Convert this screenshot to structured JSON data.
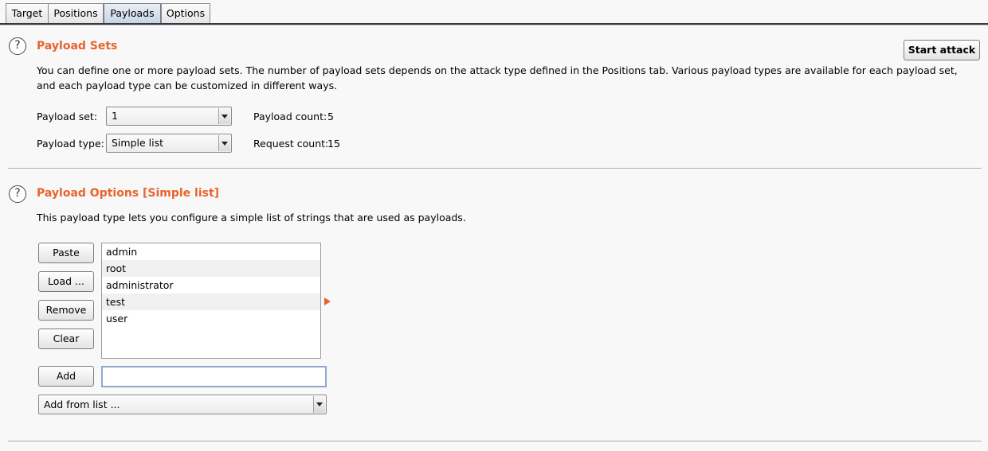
{
  "tabs": [
    {
      "label": "Target"
    },
    {
      "label": "Positions"
    },
    {
      "label": "Payloads",
      "active": true
    },
    {
      "label": "Options"
    }
  ],
  "payload_sets": {
    "title": "Payload Sets",
    "description_line1": "You can define one or more payload sets. The number of payload sets depends on the attack type defined in the Positions tab. Various payload types are available for each payload set,",
    "description_line2": "and each payload type can be customized in different ways.",
    "start_attack_label": "Start attack",
    "payload_set_label": "Payload set:",
    "payload_set_value": "1",
    "payload_type_label": "Payload type:",
    "payload_type_value": "Simple list",
    "payload_count_label": "Payload count:",
    "payload_count_value": "5",
    "request_count_label": "Request count:",
    "request_count_value": "15"
  },
  "payload_options": {
    "title": "Payload Options [Simple list]",
    "description": "This payload type lets you configure a simple list of strings that are used as payloads.",
    "paste_label": "Paste",
    "load_label": "Load ...",
    "remove_label": "Remove",
    "clear_label": "Clear",
    "add_label": "Add",
    "add_input_value": "",
    "add_from_list_label": "Add from list ...",
    "items": [
      "admin",
      "root",
      "administrator",
      "test",
      "user"
    ]
  },
  "icons": {
    "help": "help-icon",
    "dropdown": "chevron-down-icon",
    "marker": "arrow-marker-icon"
  },
  "colors": {
    "accent": "#e8642c",
    "background": "#f8f8f8"
  }
}
